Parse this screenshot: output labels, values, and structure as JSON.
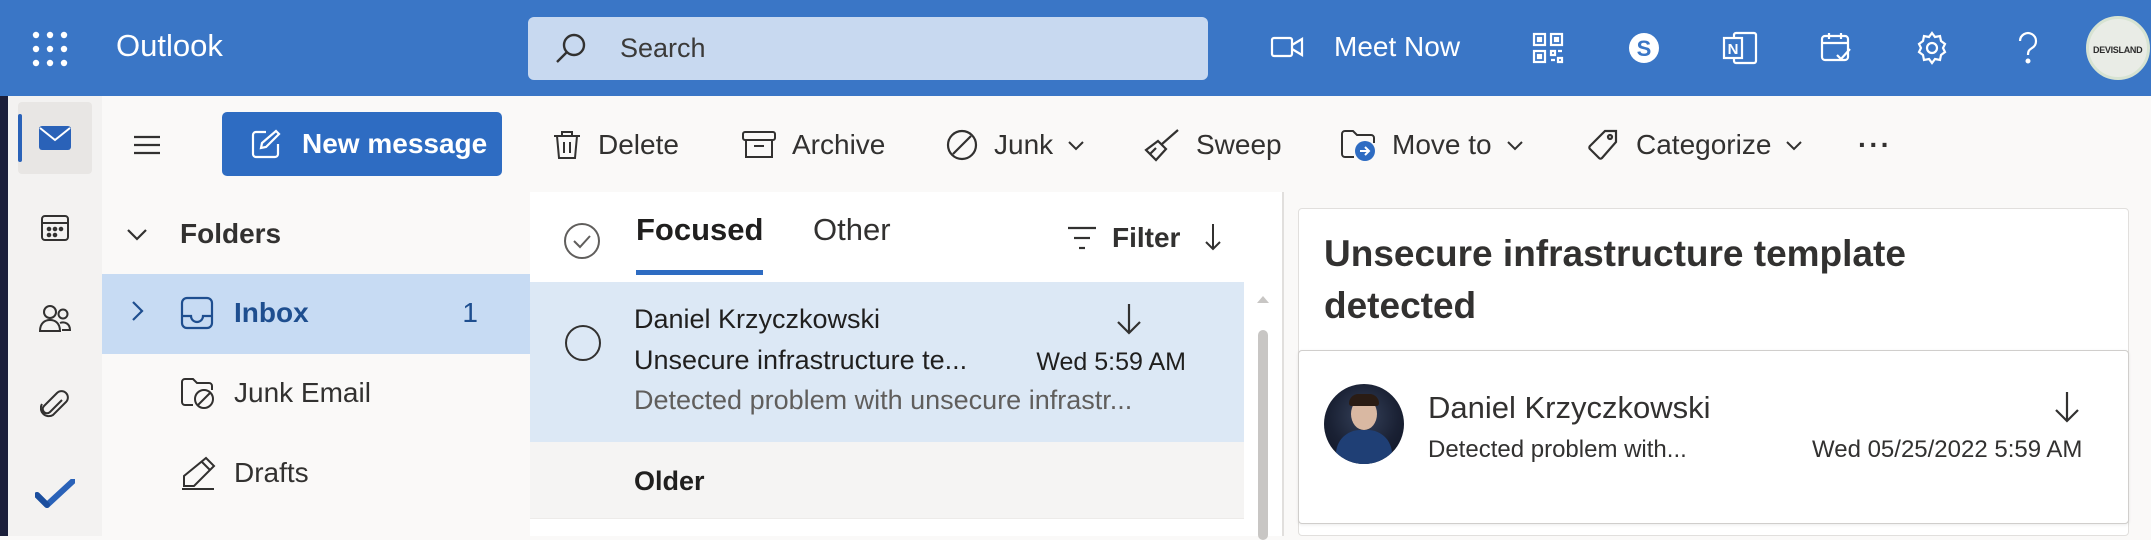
{
  "app": {
    "brand": "Outlook"
  },
  "topbar": {
    "search_placeholder": "Search",
    "meet_now_label": "Meet Now",
    "avatar_text": "DEVISLAND",
    "icons": [
      "waffle-icon",
      "search-icon",
      "video-icon",
      "qr-code-icon",
      "skype-icon",
      "onenote-icon",
      "calendar-check-icon",
      "settings-gear-icon",
      "help-icon"
    ]
  },
  "rail": {
    "items": [
      "mail-icon",
      "calendar-icon",
      "people-icon",
      "attachment-icon",
      "todo-icon"
    ]
  },
  "commandbar": {
    "new_message": "New message",
    "delete": "Delete",
    "archive": "Archive",
    "junk": "Junk",
    "sweep": "Sweep",
    "move_to": "Move to",
    "categorize": "Categorize",
    "more": "···"
  },
  "folders": {
    "header": "Folders",
    "items": [
      {
        "name": "Inbox",
        "count": "1"
      },
      {
        "name": "Junk Email"
      },
      {
        "name": "Drafts"
      }
    ]
  },
  "list": {
    "tabs": {
      "focused": "Focused",
      "other": "Other"
    },
    "filter": "Filter",
    "messages": [
      {
        "sender": "Daniel Krzyczkowski",
        "subject": "Unsecure infrastructure te...",
        "time": "Wed 5:59 AM",
        "preview": "Detected problem with unsecure infrastr..."
      }
    ],
    "group_older": "Older"
  },
  "reading": {
    "title": "Unsecure infrastructure template detected",
    "sender": "Daniel Krzyczkowski",
    "preview": "Detected problem with...",
    "date": "Wed 05/25/2022 5:59 AM"
  },
  "colors": {
    "topbar": "#3a76c6",
    "accent": "#2e6cc2",
    "selected_folder": "#c7dbf3",
    "selected_message": "#dce8f5"
  }
}
